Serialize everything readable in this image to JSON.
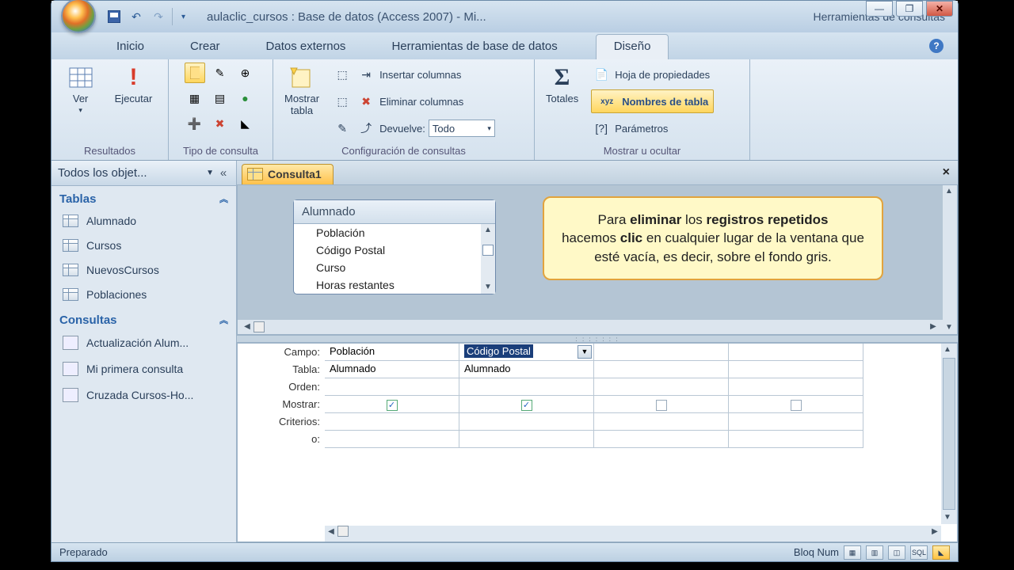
{
  "title": "aulaclic_cursos : Base de datos (Access 2007) - Mi...",
  "contextual_tab": "Herramientas de consultas",
  "tabs": {
    "home": "Inicio",
    "create": "Crear",
    "external": "Datos externos",
    "dbtools": "Herramientas de base de datos",
    "design": "Diseño"
  },
  "ribbon": {
    "group_results": "Resultados",
    "ver": "Ver",
    "ejecutar": "Ejecutar",
    "group_qtype": "Tipo de consulta",
    "group_qsetup": "Configuración de consultas",
    "mostrar_tabla": "Mostrar\ntabla",
    "ins_cols": "Insertar columnas",
    "del_cols": "Eliminar columnas",
    "devuelve": "Devuelve:",
    "devuelve_val": "Todo",
    "group_showhide": "Mostrar u ocultar",
    "totales": "Totales",
    "hoja_prop": "Hoja de propiedades",
    "nombres_tabla": "Nombres de tabla",
    "parametros": "Parámetros"
  },
  "nav": {
    "header": "Todos los objet...",
    "sec_tables": "Tablas",
    "sec_queries": "Consultas",
    "tables": [
      "Alumnado",
      "Cursos",
      "NuevosCursos",
      "Poblaciones"
    ],
    "queries": [
      "Actualización Alum...",
      "Mi primera consulta",
      "Cruzada Cursos-Ho..."
    ]
  },
  "doc": {
    "tab": "Consulta1"
  },
  "table_box": {
    "title": "Alumnado",
    "fields": [
      "Población",
      "Código Postal",
      "Curso",
      "Horas restantes"
    ]
  },
  "callout": {
    "l1a": "Para ",
    "l1b": "eliminar",
    "l1c": " los ",
    "l1d": "registros repetidos",
    "l2a": "hacemos ",
    "l2b": "clic",
    "l2c": " en cualquier lugar de la ventana que esté vacía, es decir, sobre el fondo gris."
  },
  "grid": {
    "labels": {
      "campo": "Campo:",
      "tabla": "Tabla:",
      "orden": "Orden:",
      "mostrar": "Mostrar:",
      "criterios": "Criterios:",
      "o": "o:"
    },
    "cols": [
      {
        "campo": "Población",
        "tabla": "Alumnado",
        "mostrar": true,
        "selected": false
      },
      {
        "campo": "Código Postal",
        "tabla": "Alumnado",
        "mostrar": true,
        "selected": true
      },
      {
        "campo": "",
        "tabla": "",
        "mostrar": false,
        "selected": false
      },
      {
        "campo": "",
        "tabla": "",
        "mostrar": false,
        "selected": false
      }
    ]
  },
  "status": {
    "ready": "Preparado",
    "numlock": "Bloq Num",
    "sql": "SQL"
  }
}
